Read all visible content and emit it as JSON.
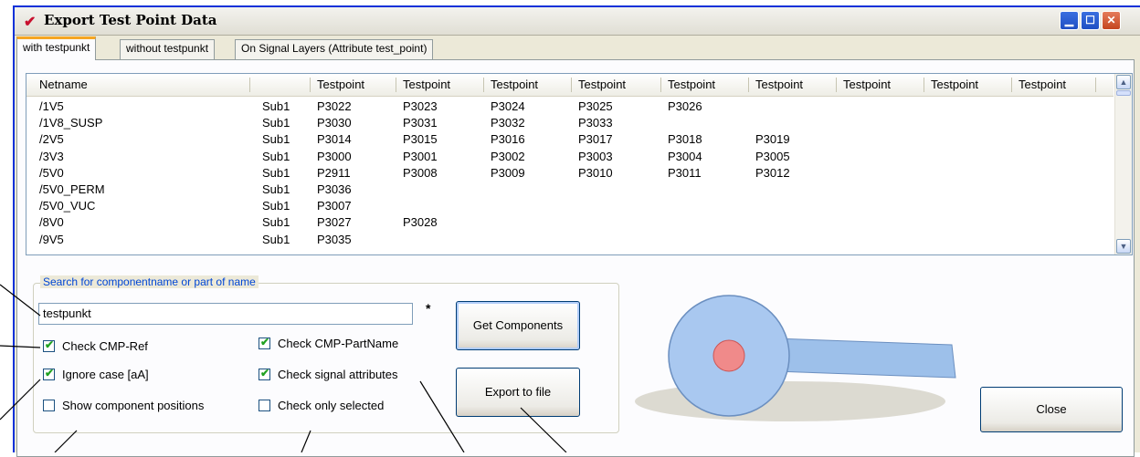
{
  "window": {
    "title": "Export Test Point Data"
  },
  "tabs": [
    "with testpunkt",
    "without testpunkt",
    "On Signal Layers (Attribute test_point)"
  ],
  "table": {
    "headers": [
      "Netname",
      "",
      "Testpoint",
      "Testpoint",
      "Testpoint",
      "Testpoint",
      "Testpoint",
      "Testpoint",
      "Testpoint",
      "Testpoint",
      "Testpoint"
    ],
    "rows": [
      [
        "/1V5",
        "Sub1",
        "P3022",
        "P3023",
        "P3024",
        "P3025",
        "P3026",
        ""
      ],
      [
        "/1V8_SUSP",
        "Sub1",
        "P3030",
        "P3031",
        "P3032",
        "P3033",
        "",
        ""
      ],
      [
        "/2V5",
        "Sub1",
        "P3014",
        "P3015",
        "P3016",
        "P3017",
        "P3018",
        "P3019"
      ],
      [
        "/3V3",
        "Sub1",
        "P3000",
        "P3001",
        "P3002",
        "P3003",
        "P3004",
        "P3005"
      ],
      [
        "/5V0",
        "Sub1",
        "P2911",
        "P3008",
        "P3009",
        "P3010",
        "P3011",
        "P3012"
      ],
      [
        "/5V0_PERM",
        "Sub1",
        "P3036",
        "",
        "",
        "",
        "",
        ""
      ],
      [
        "/5V0_VUC",
        "Sub1",
        "P3007",
        "",
        "",
        "",
        "",
        ""
      ],
      [
        "/8V0",
        "Sub1",
        "P3027",
        "P3028",
        "",
        "",
        "",
        ""
      ],
      [
        "/9V5",
        "Sub1",
        "P3035",
        "",
        "",
        "",
        "",
        ""
      ]
    ]
  },
  "search": {
    "legend": "Search for componentname or part of name",
    "value": "testpunkt",
    "wildcard": "*"
  },
  "checkboxes": {
    "check_cmp_ref": {
      "label": "Check CMP-Ref",
      "checked": true
    },
    "ignore_case": {
      "label": "Ignore case [aA]",
      "checked": true
    },
    "show_positions": {
      "label": "Show component positions",
      "checked": false
    },
    "check_partname": {
      "label": "Check CMP-PartName",
      "checked": true
    },
    "check_signal_attr": {
      "label": "Check signal attributes",
      "checked": true
    },
    "check_only_selected": {
      "label": "Check only selected",
      "checked": false
    }
  },
  "buttons": {
    "get_components": "Get Components",
    "export_to_file": "Export to file",
    "close": "Close"
  },
  "colors": {
    "tab_accent": "#f5a623",
    "link_blue": "#0046d5",
    "pad_blue": "#a9c8f0",
    "pad_red": "#f08a8a"
  }
}
